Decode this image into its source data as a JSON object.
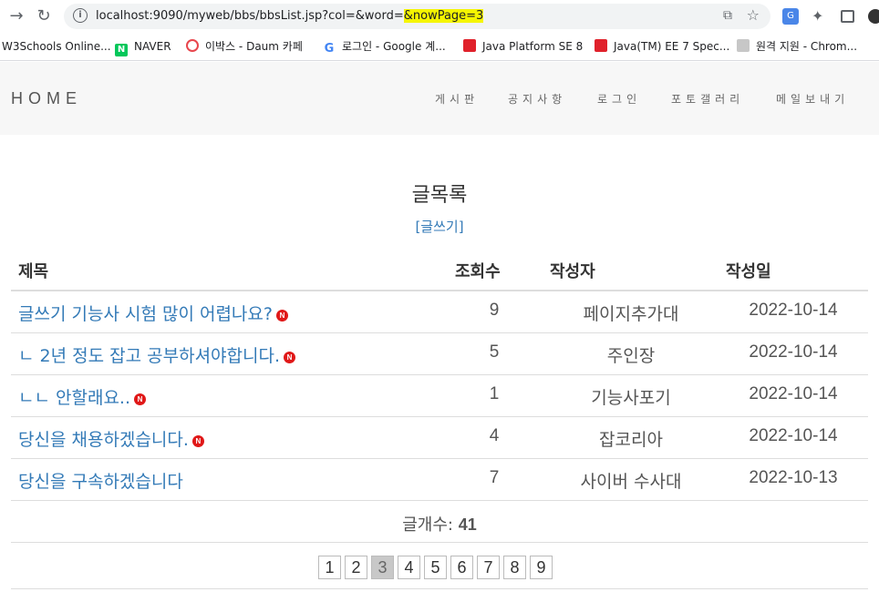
{
  "browser": {
    "url_prefix": "localhost:9090/myweb/bbs/bbsList.jsp?col=&word=",
    "url_highlight": "&nowPage=3"
  },
  "bookmarks": [
    {
      "label": "W3Schools Online..."
    },
    {
      "label": "NAVER",
      "icon": "naver-icon"
    },
    {
      "label": "이박스 - Daum 카페",
      "icon": "daum-icon"
    },
    {
      "label": "로그인 - Google 계...",
      "icon": "google-icon"
    },
    {
      "label": "Java Platform SE 8",
      "icon": "oracle-icon"
    },
    {
      "label": "Java(TM) EE 7 Spec...",
      "icon": "oracle-icon"
    },
    {
      "label": "원격 지원 - Chrom...",
      "icon": "remote-icon"
    }
  ],
  "site": {
    "logo": "HOME",
    "menu": [
      "게시판",
      "공지사항",
      "로그인",
      "포토갤러리",
      "메일보내기"
    ]
  },
  "board": {
    "title": "글목록",
    "write_link": "[글쓰기]",
    "headers": {
      "title": "제목",
      "views": "조회수",
      "author": "작성자",
      "date": "작성일"
    },
    "rows": [
      {
        "title": "글쓰기 기능사 시험 많이 어렵나요?",
        "views": "9",
        "author": "페이지추가대",
        "date": "2022-10-14",
        "is_new": true
      },
      {
        "title": "ㄴ 2년 정도 잡고 공부하셔야합니다.",
        "views": "5",
        "author": "주인장",
        "date": "2022-10-14",
        "is_new": true
      },
      {
        "title": "ㄴㄴ 안할래요..",
        "views": "1",
        "author": "기능사포기",
        "date": "2022-10-14",
        "is_new": true
      },
      {
        "title": "당신을 채용하겠습니다.",
        "views": "4",
        "author": "잡코리아",
        "date": "2022-10-14",
        "is_new": true
      },
      {
        "title": "당신을 구속하겠습니다",
        "views": "7",
        "author": "사이버 수사대",
        "date": "2022-10-13",
        "is_new": false
      }
    ],
    "count_label": "글개수:",
    "count_value": "41",
    "pages": [
      "1",
      "2",
      "3",
      "4",
      "5",
      "6",
      "7",
      "8",
      "9"
    ],
    "current_page": "3",
    "new_badge": "N"
  }
}
